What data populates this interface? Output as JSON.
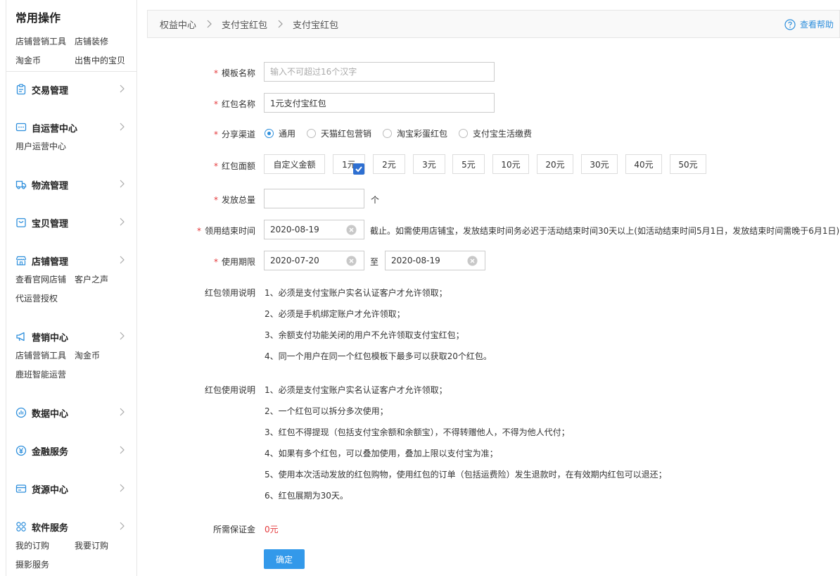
{
  "sidebar": {
    "common": {
      "title": "常用操作",
      "links": [
        "店铺营销工具",
        "店铺装修",
        "淘金币",
        "出售中的宝贝"
      ]
    },
    "sections": [
      {
        "title": "交易管理",
        "icon": "clipboard-icon",
        "links": []
      },
      {
        "title": "自运营中心",
        "icon": "chat-icon",
        "links": [
          "用户运营中心"
        ]
      },
      {
        "title": "物流管理",
        "icon": "truck-icon",
        "links": []
      },
      {
        "title": "宝贝管理",
        "icon": "bag-icon",
        "links": []
      },
      {
        "title": "店铺管理",
        "icon": "store-icon",
        "links": [
          "查看官网店铺",
          "客户之声",
          "代运营授权"
        ]
      },
      {
        "title": "营销中心",
        "icon": "megaphone-icon",
        "links": [
          "店铺营销工具",
          "淘金币",
          "鹿班智能运营"
        ]
      },
      {
        "title": "数据中心",
        "icon": "data-icon",
        "links": []
      },
      {
        "title": "金融服务",
        "icon": "yen-icon",
        "links": []
      },
      {
        "title": "货源中心",
        "icon": "card-icon",
        "links": []
      },
      {
        "title": "软件服务",
        "icon": "apps-icon",
        "links": [
          "我的订购",
          "我要订购",
          "摄影服务"
        ]
      }
    ]
  },
  "breadcrumb": {
    "items": [
      "权益中心",
      "支付宝红包",
      "支付宝红包"
    ],
    "help": "查看帮助"
  },
  "form": {
    "template_name": {
      "label": "模板名称",
      "placeholder": "输入不可超过16个汉字",
      "value": ""
    },
    "packet_name": {
      "label": "红包名称",
      "value": "1元支付宝红包"
    },
    "channel": {
      "label": "分享渠道",
      "options": [
        "通用",
        "天猫红包营销",
        "淘宝彩蛋红包",
        "支付宝生活缴费"
      ],
      "selected": "通用"
    },
    "face_value": {
      "label": "红包面额",
      "options": [
        "自定义金额",
        "1元",
        "2元",
        "3元",
        "5元",
        "10元",
        "20元",
        "30元",
        "40元",
        "50元"
      ],
      "selected": "1元"
    },
    "total": {
      "label": "发放总量",
      "value": "",
      "unit": "个"
    },
    "claim_end": {
      "label": "领用结束时间",
      "value": "2020-08-19",
      "note": "截止。如需使用店铺宝，发放结束时间务必迟于活动结束时间30天以上(如活动结束时间5月1日，发放结束时间需晚于6月1日)"
    },
    "use_period": {
      "label": "使用期限",
      "start": "2020-07-20",
      "sep": "至",
      "end": "2020-08-19"
    },
    "claim_desc": {
      "label": "红包领用说明",
      "lines": [
        "1、必须是支付宝账户实名认证客户才允许领取；",
        "2、必须是手机绑定账户才允许领取；",
        "3、余额支付功能关闭的用户不允许领取支付宝红包；",
        "4、同一个用户在同一个红包模板下最多可以获取20个红包。"
      ]
    },
    "use_desc": {
      "label": "红包使用说明",
      "lines": [
        "1、必须是支付宝账户实名认证客户才允许领取；",
        "2、一个红包可以拆分多次使用；",
        "3、红包不得提现（包括支付宝余额和余额宝），不得转赠他人，不得为他人代付；",
        "4、如果有多个红包，可以叠加使用，叠加上限以支付宝为准；",
        "5、使用本次活动发放的红包购物，使用红包的订单（包括运费险）发生退款时，在有效期内红包可以退还；",
        "6、红包展期为30天。"
      ]
    },
    "deposit": {
      "label": "所需保证金",
      "value": "0元"
    },
    "confirm": "确定"
  },
  "colors": {
    "accent": "#2e8fdc",
    "required": "#e4393c",
    "button": "#3399ea"
  }
}
